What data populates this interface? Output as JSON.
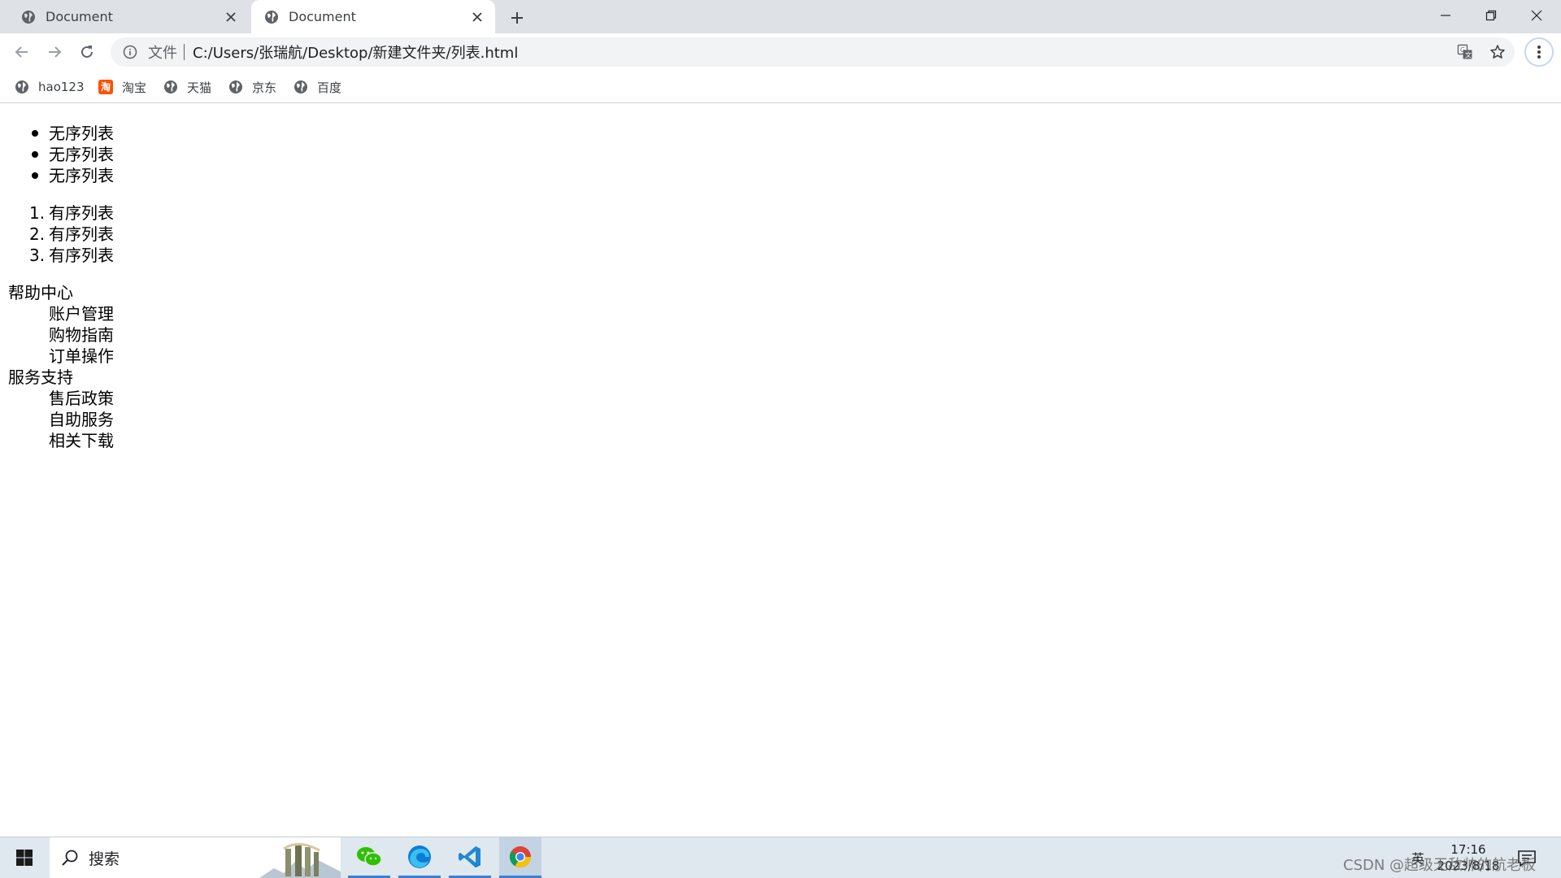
{
  "tabs": [
    {
      "title": "Document",
      "active": false
    },
    {
      "title": "Document",
      "active": true
    }
  ],
  "toolbar": {
    "scheme_label": "文件",
    "url": "C:/Users/张瑞航/Desktop/新建文件夹/列表.html"
  },
  "bookmarks": [
    {
      "label": "hao123",
      "icon": "globe-icon"
    },
    {
      "label": "淘宝",
      "icon": "taobao-icon"
    },
    {
      "label": "天猫",
      "icon": "globe-icon"
    },
    {
      "label": "京东",
      "icon": "globe-icon"
    },
    {
      "label": "百度",
      "icon": "globe-icon"
    }
  ],
  "page": {
    "unordered": [
      "无序列表",
      "无序列表",
      "无序列表"
    ],
    "ordered": [
      {
        "marker": "1.",
        "text": "有序列表"
      },
      {
        "marker": "2.",
        "text": "有序列表"
      },
      {
        "marker": "3.",
        "text": "有序列表"
      }
    ],
    "definitions": [
      {
        "term": "帮助中心",
        "items": [
          "账户管理",
          "购物指南",
          "订单操作"
        ]
      },
      {
        "term": "服务支持",
        "items": [
          "售后政策",
          "自助服务",
          "相关下载"
        ]
      }
    ]
  },
  "taskbar": {
    "search_placeholder": "搜索",
    "ime_label": "英",
    "time": "17:16",
    "date": "2023/8/18",
    "watermark": "CSDN @超级无敌帅的航老板"
  },
  "colors": {
    "tabstrip_bg": "#dee1e6",
    "omnibox_bg": "#f1f3f4",
    "taskbar_bg": "#dfe7ef",
    "taskbar_accent": "#3b7fd4"
  }
}
